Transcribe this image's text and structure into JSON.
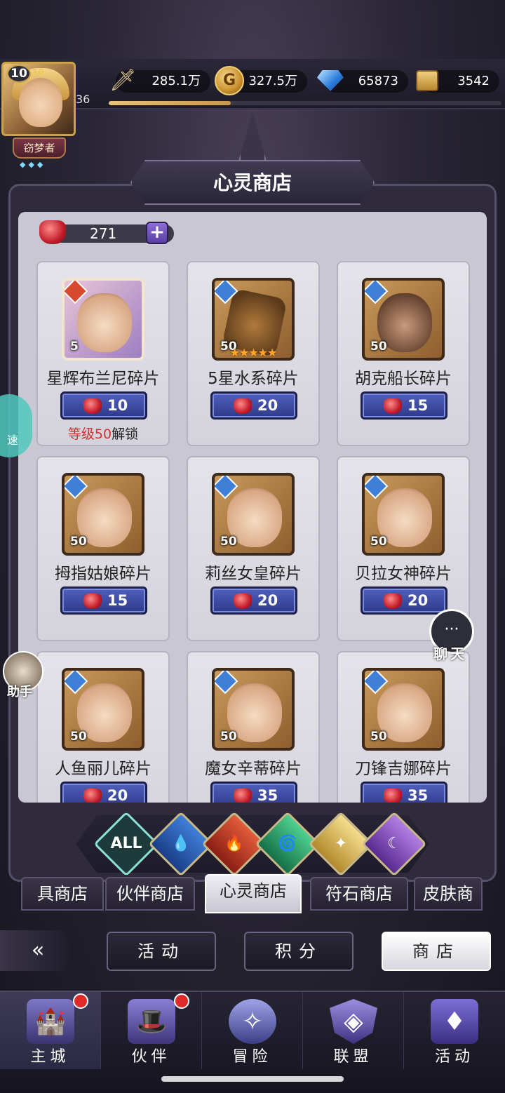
{
  "player": {
    "vip_level": "10",
    "vip_sub": "10",
    "level": "36",
    "title": "窃梦者",
    "xp_fraction": 0.31
  },
  "resources": [
    {
      "icon": "sword-power-icon",
      "value": "285.1万"
    },
    {
      "icon": "gold-coin-icon",
      "value": "327.5万"
    },
    {
      "icon": "diamond-icon",
      "value": "65873"
    },
    {
      "icon": "scroll-icon",
      "value": "3542"
    }
  ],
  "shop": {
    "title": "心灵商店",
    "currency_value": "271",
    "plus_label": "+",
    "items": [
      {
        "name": "星辉布兰尼碎片",
        "price": "10",
        "count": "5",
        "element": "fire",
        "lock": {
          "prefix": "等级50",
          "suffix": "解锁"
        }
      },
      {
        "name": "5星水系碎片",
        "price": "20",
        "count": "50",
        "element": "water",
        "stars": "★★★★★"
      },
      {
        "name": "胡克船长碎片",
        "price": "15",
        "count": "50",
        "element": "water"
      },
      {
        "name": "拇指姑娘碎片",
        "price": "15",
        "count": "50",
        "element": "water"
      },
      {
        "name": "莉丝女皇碎片",
        "price": "20",
        "count": "50",
        "element": "water"
      },
      {
        "name": "贝拉女神碎片",
        "price": "20",
        "count": "50",
        "element": "water"
      },
      {
        "name": "人鱼丽儿碎片",
        "price": "20",
        "count": "50",
        "element": "water"
      },
      {
        "name": "魔女辛蒂碎片",
        "price": "35",
        "count": "50",
        "element": "water"
      },
      {
        "name": "刀锋吉娜碎片",
        "price": "35",
        "count": "50",
        "element": "water"
      }
    ]
  },
  "filters": {
    "all_label": "ALL"
  },
  "shop_tabs": [
    "具商店",
    "伙伴商店",
    "心灵商店",
    "符石商店",
    "皮肤商"
  ],
  "subnav": {
    "activity": "活动",
    "points": "积分",
    "shop": "商店"
  },
  "bottom_nav": [
    "主城",
    "伙伴",
    "冒险",
    "联盟",
    "活动"
  ],
  "floating": {
    "speed": "速",
    "assistant": "助手",
    "chat": "聊天"
  }
}
